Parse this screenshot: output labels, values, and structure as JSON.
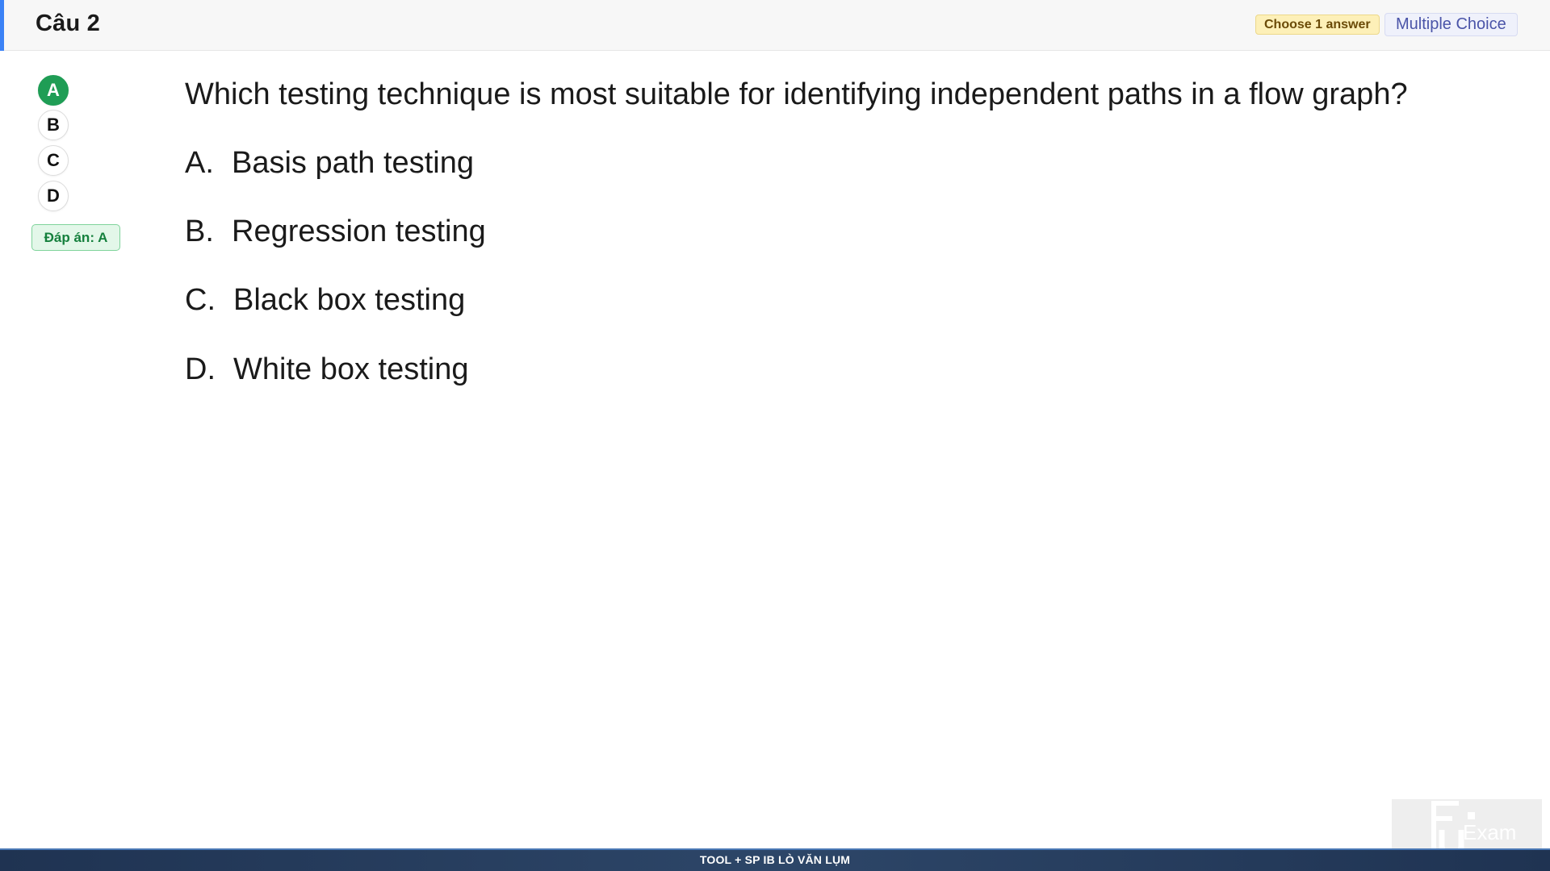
{
  "header": {
    "title": "Câu 2",
    "choose_badge": "Choose 1 answer",
    "type_badge": "Multiple Choice",
    "accent_color": "#3b82f6"
  },
  "selector": {
    "options": [
      "A",
      "B",
      "C",
      "D"
    ],
    "selected": "A",
    "answer_label": "Đáp án: A",
    "selected_color": "#1f9d55"
  },
  "question": {
    "text": "Which testing technique is most suitable for identifying independent paths in a flow graph?",
    "options": [
      {
        "letter": "A.",
        "text": "Basis path testing"
      },
      {
        "letter": "B.",
        "text": "Regression testing"
      },
      {
        "letter": "C.",
        "text": "Black box testing"
      },
      {
        "letter": "D.",
        "text": "White box testing"
      }
    ]
  },
  "footer": {
    "text": "TOOL + SP IB LÒ VĂN LỤM"
  },
  "logo": {
    "brand_text": "Exam",
    "icon": "fu-exam-logo"
  }
}
